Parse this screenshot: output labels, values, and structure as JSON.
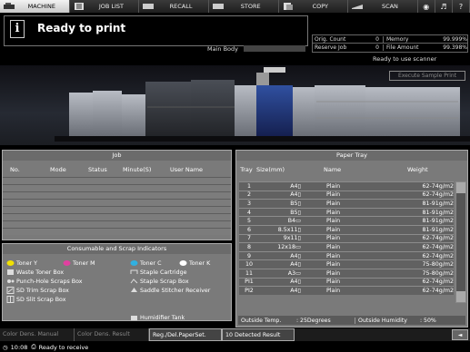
{
  "tabs": [
    {
      "name": "tab-machine",
      "label": "MACHINE",
      "active": true
    },
    {
      "name": "tab-job-list",
      "label": "JOB LIST",
      "active": false
    },
    {
      "name": "tab-recall",
      "label": "RECALL",
      "active": false
    },
    {
      "name": "tab-store",
      "label": "STORE",
      "active": false
    },
    {
      "name": "tab-copy",
      "label": "COPY",
      "active": false
    },
    {
      "name": "tab-scan",
      "label": "SCAN",
      "active": false
    }
  ],
  "header": {
    "message": "Ready to print",
    "main_body_label": "Main Body",
    "scanner_status": "Ready to use scanner",
    "execute_sample_label": "Execute Sample Print"
  },
  "counters": {
    "orig_count_label": "Orig. Count",
    "orig_count_value": "0",
    "memory_label": "Memory",
    "memory_value": "99.999%",
    "reserve_job_label": "Reserve Job",
    "reserve_job_value": "0",
    "file_amount_label": "File Amount",
    "file_amount_value": "99.398%"
  },
  "job": {
    "title": "Job",
    "columns": [
      "No.",
      "Mode",
      "Status",
      "Minute(S)",
      "User Name"
    ]
  },
  "consumables": {
    "title": "Consumable and Scrap Indicators",
    "items": {
      "toner_y": "Toner Y",
      "toner_m": "Toner M",
      "toner_c": "Toner C",
      "toner_k": "Toner K",
      "waste_toner": "Waste Toner Box",
      "staple_cartridge": "Staple Cartridge",
      "punch_hole": "Punch-Hole Scraps Box",
      "staple_scrap": "Staple Scrap Box",
      "sd_trim": "SD Trim Scrap Box",
      "saddle_stitcher": "Saddle Stitcher Receiver",
      "sd_slit": "SD Slit Scrap Box",
      "humidifier": "Humidifier Tank"
    }
  },
  "paper_tray": {
    "title": "Paper Tray",
    "columns": [
      "Tray",
      "Size(mm)",
      "Name",
      "Weight"
    ],
    "rows": [
      {
        "tray": "1",
        "size": "A4▯",
        "name": "Plain",
        "weight": "62-74g/m2"
      },
      {
        "tray": "2",
        "size": "A4▯",
        "name": "Plain",
        "weight": "62-74g/m2"
      },
      {
        "tray": "3",
        "size": "B5▯",
        "name": "Plain",
        "weight": "81-91g/m2"
      },
      {
        "tray": "4",
        "size": "B5▯",
        "name": "Plain",
        "weight": "81-91g/m2"
      },
      {
        "tray": "5",
        "size": "B4▭",
        "name": "Plain",
        "weight": "81-91g/m2"
      },
      {
        "tray": "6",
        "size": "8.5x11▯",
        "name": "Plain",
        "weight": "81-91g/m2"
      },
      {
        "tray": "7",
        "size": "9x11▯",
        "name": "Plain",
        "weight": "62-74g/m2"
      },
      {
        "tray": "8",
        "size": "12x18▭",
        "name": "Plain",
        "weight": "62-74g/m2"
      },
      {
        "tray": "9",
        "size": "A4▯",
        "name": "Plain",
        "weight": "62-74g/m2"
      },
      {
        "tray": "10",
        "size": "A4▯",
        "name": "Plain",
        "weight": "75-80g/m2"
      },
      {
        "tray": "11",
        "size": "A3▭",
        "name": "Plain",
        "weight": "75-80g/m2"
      },
      {
        "tray": "PI1",
        "size": "A4▯",
        "name": "Plain",
        "weight": "62-74g/m2"
      },
      {
        "tray": "PI2",
        "size": "A4▯",
        "name": "Plain",
        "weight": "62-74g/m2"
      }
    ],
    "outside_temp_label": "Outside Temp.",
    "outside_temp_value": ": 25Degrees",
    "outside_humidity_label": "Outside Humidity",
    "outside_humidity_value": ": 50%"
  },
  "bottom_tabs": [
    {
      "label": "Color Dens. Manual",
      "active": false
    },
    {
      "label": "Color Dens. Result",
      "active": false
    },
    {
      "label": "Reg./Del.PaperSet.",
      "active": true
    },
    {
      "label": "10 Detected Result",
      "active": false
    }
  ],
  "back_label": "◄",
  "status": {
    "time": "10:08",
    "text": "Ready to receive"
  },
  "colors": {
    "toner_y": "#f0e000",
    "toner_m": "#e040a0",
    "toner_c": "#30b0e0",
    "toner_k": "#ffffff",
    "panel_bg": "#7a7a7a",
    "active_tab": "#e0e0e0"
  }
}
